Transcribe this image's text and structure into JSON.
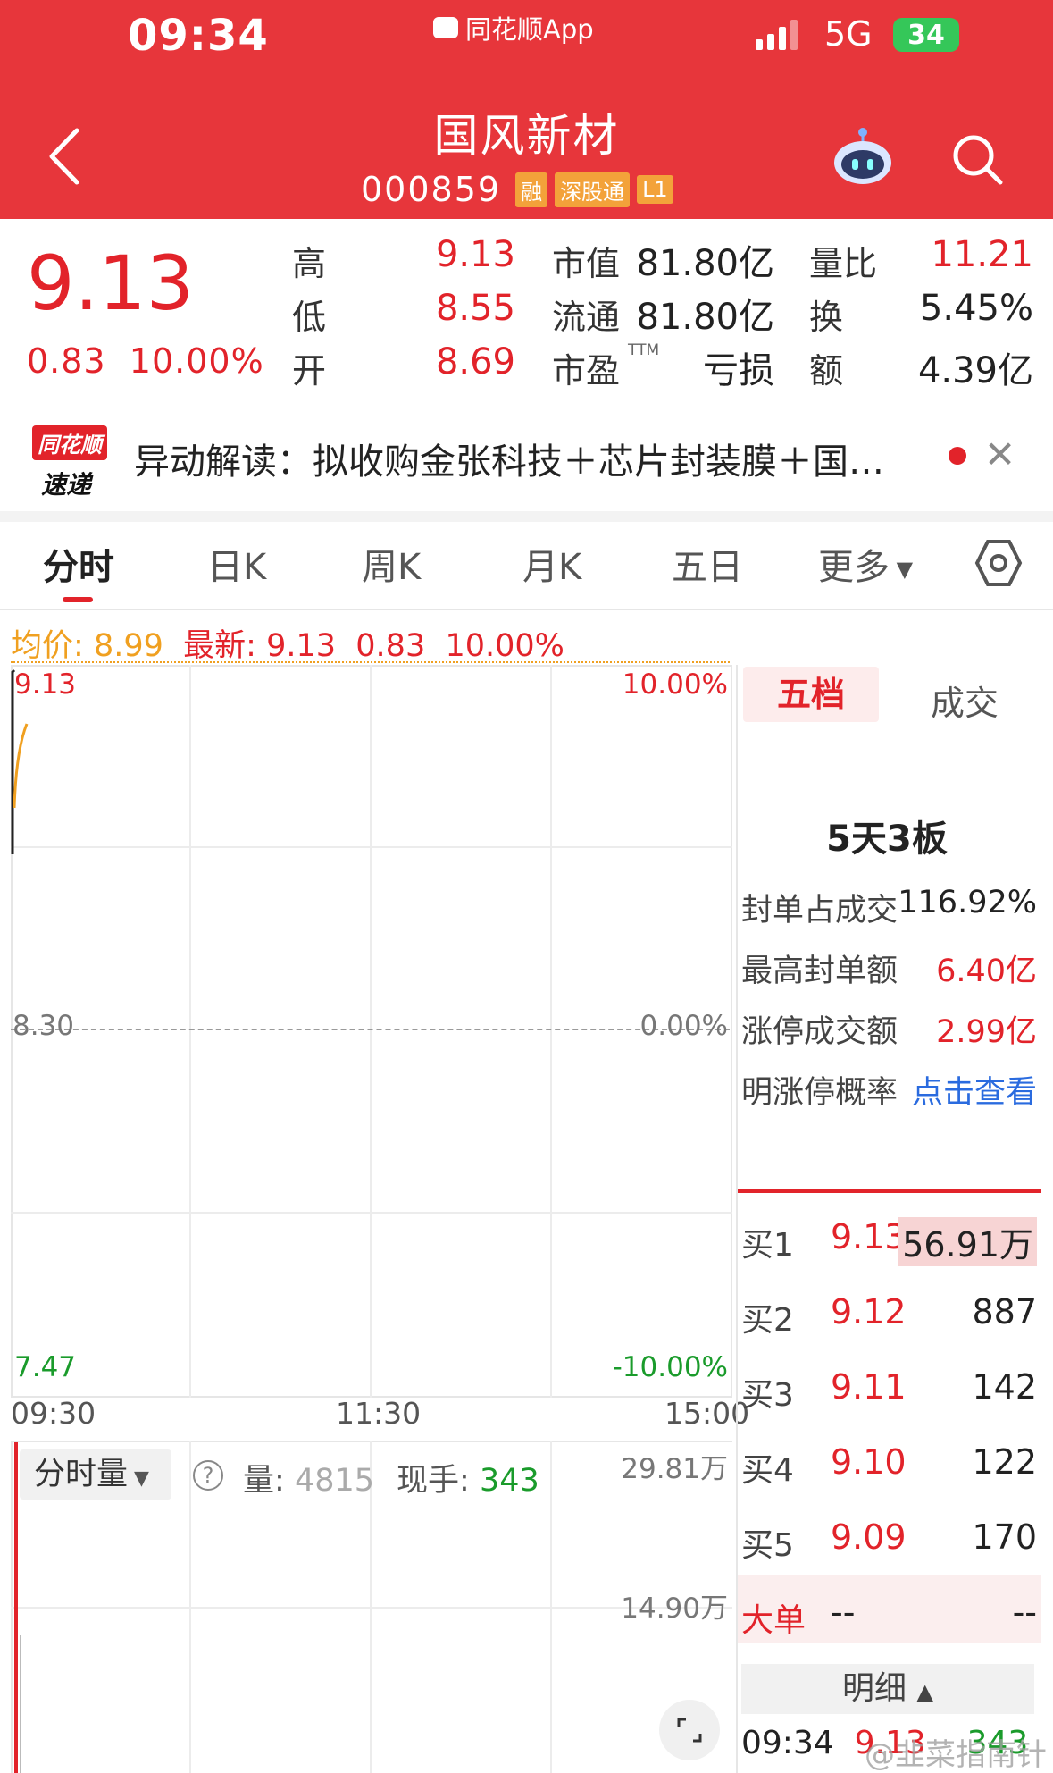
{
  "status_bar": {
    "time": "09:34",
    "app": "同花顺App",
    "network": "5G",
    "battery": "34"
  },
  "stock": {
    "name": "国风新材",
    "code": "000859",
    "tags": [
      "融",
      "深股通",
      "L1"
    ]
  },
  "quote": {
    "price": "9.13",
    "change": "0.83",
    "change_pct": "10.00%",
    "high_label": "高",
    "high": "9.13",
    "low_label": "低",
    "low": "8.55",
    "open_label": "开",
    "open": "8.69",
    "mktcap_label": "市值",
    "mktcap": "81.80亿",
    "float_label": "流通",
    "float": "81.80亿",
    "pe_label": "市盈",
    "pe_sup": "TTM",
    "pe": "亏损",
    "vol_ratio_label": "量比",
    "vol_ratio": "11.21",
    "turnover_label": "换",
    "turnover": "5.45%",
    "amount_label": "额",
    "amount": "4.39亿"
  },
  "news": {
    "logo_top": "同花顺",
    "logo_bottom": "速递",
    "text": "异动解读：拟收购金张科技＋芯片封装膜＋国…"
  },
  "tabs": [
    "分时",
    "日K",
    "周K",
    "月K",
    "五日",
    "更多"
  ],
  "chart_header": {
    "avg_label": "均价:",
    "avg": "8.99",
    "latest_label": "最新:",
    "latest": "9.13",
    "change": "0.83",
    "pct": "10.00%"
  },
  "chart": {
    "y_top": "9.13",
    "y_mid": "8.30",
    "y_bot": "7.47",
    "pct_top": "10.00%",
    "pct_mid": "0.00%",
    "pct_bot": "-10.00%",
    "times": [
      "09:30",
      "11:30",
      "15:00"
    ]
  },
  "side_panel": {
    "tabs": [
      "五档",
      "成交"
    ],
    "board_title": "5天3板",
    "seal": [
      {
        "label": "封单占成交",
        "value": "116.92%"
      },
      {
        "label": "最高封单额",
        "value": "6.40亿"
      },
      {
        "label": "涨停成交额",
        "value": "2.99亿"
      },
      {
        "label": "明涨停概率",
        "value": "点击查看"
      }
    ],
    "bids": [
      {
        "label": "买1",
        "price": "9.13",
        "vol": "56.91万"
      },
      {
        "label": "买2",
        "price": "9.12",
        "vol": "887"
      },
      {
        "label": "买3",
        "price": "9.11",
        "vol": "142"
      },
      {
        "label": "买4",
        "price": "9.10",
        "vol": "122"
      },
      {
        "label": "买5",
        "price": "9.09",
        "vol": "170"
      }
    ],
    "big_order": {
      "label": "大单",
      "price": "--",
      "vol": "--"
    },
    "detail_label": "明细",
    "tick": {
      "time": "09:34",
      "price": "9.13",
      "vol": "343"
    }
  },
  "volume_panel": {
    "selector": "分时量",
    "vol_label": "量:",
    "vol": "4815",
    "hand_label": "现手:",
    "hand": "343",
    "y_top": "29.81万",
    "y_mid": "14.90万"
  },
  "watermark": "@韭菜指南针",
  "colors": {
    "brand_red": "#e7363b",
    "up_red": "#e2232a",
    "down_green": "#1a9b2b",
    "avg_orange": "#f0a020",
    "link_blue": "#2a6bdf"
  }
}
